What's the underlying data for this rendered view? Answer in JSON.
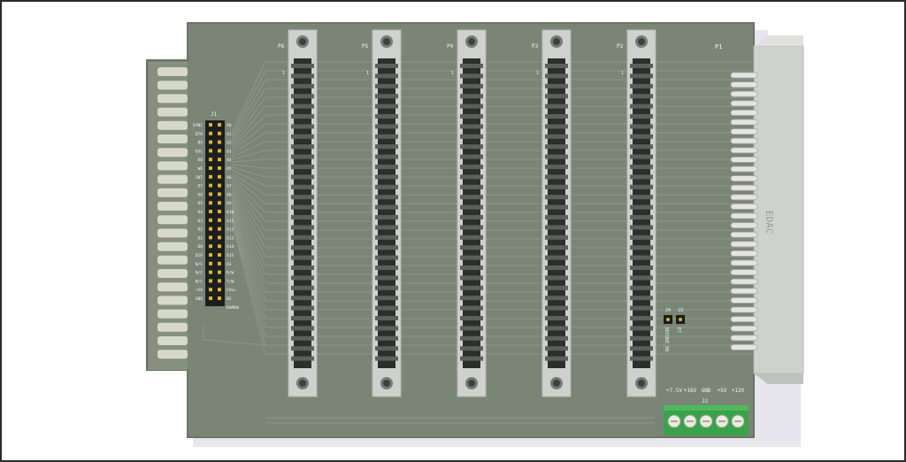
{
  "colors": {
    "board": "#7b8576",
    "board_edge": "#6a7366",
    "trace": "#8e988a",
    "copper": "#d7d9c8",
    "connector_body": "#cfd1cf",
    "connector_slot": "#2c2f2c",
    "terminal_green": "#3aa24a",
    "silk": "#f2f2f2",
    "edge_card": "#c8cbc6"
  },
  "slots": [
    {
      "ref": "P6",
      "pin1": "1"
    },
    {
      "ref": "P5",
      "pin1": "1"
    },
    {
      "ref": "P4",
      "pin1": "1"
    },
    {
      "ref": "P3",
      "pin1": "1"
    },
    {
      "ref": "P2",
      "pin1": "1"
    }
  ],
  "p1": {
    "ref": "P1",
    "side_text": "EDAC"
  },
  "j1": {
    "ref": "J1",
    "left_labels": [
      "SYNC",
      "DTR",
      "BS",
      "DSC",
      "D0",
      "WE",
      "INT",
      "D7",
      "D6",
      "D5",
      "D4",
      "D3",
      "D2",
      "D1",
      "D0",
      "DIR",
      "N/C",
      "N/C",
      "N/C",
      "+5V",
      "GND"
    ],
    "right_labels": [
      "A0",
      "A1",
      "A2",
      "A3",
      "A4",
      "A5",
      "A6",
      "A7",
      "A8",
      "A9",
      "A10",
      "A11",
      "A12",
      "A13",
      "A14",
      "A15",
      "A3",
      "R/W",
      "T/W",
      "FULL",
      "BS",
      "RAMRW"
    ]
  },
  "jumpers": {
    "refs": [
      "J4",
      "J3"
    ],
    "label": "DECODE_EN",
    "sub": "E7"
  },
  "j2": {
    "ref": "J2",
    "labels": [
      "+7.5V",
      "+16V",
      "GND",
      "+5V",
      "+12V"
    ]
  }
}
